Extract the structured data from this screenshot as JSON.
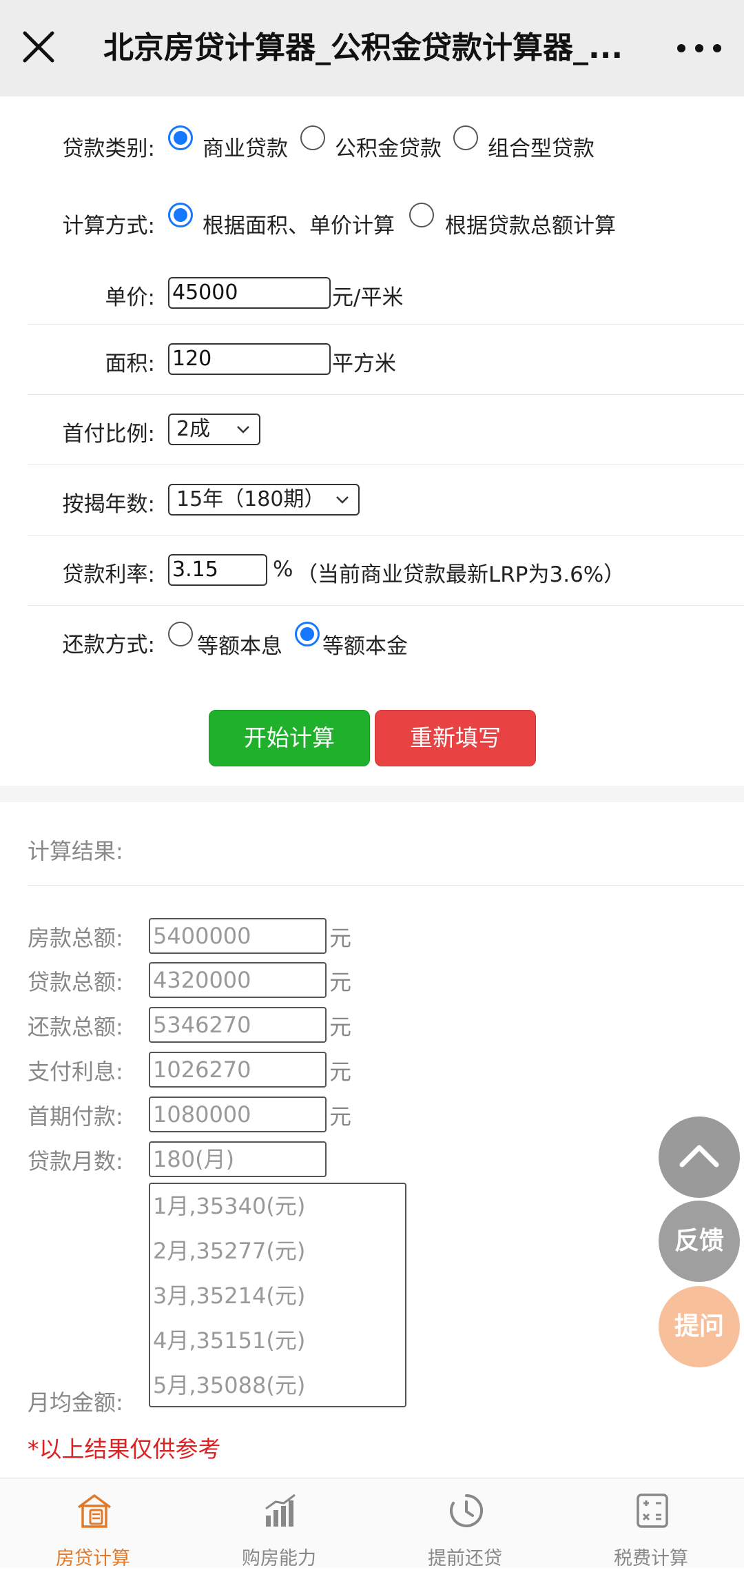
{
  "header": {
    "title": "北京房贷计算器_公积金贷款计算器_..."
  },
  "form": {
    "loan_type": {
      "label": "贷款类别:",
      "options": [
        "商业贷款",
        "公积金贷款",
        "组合型贷款"
      ],
      "selected": "商业贷款"
    },
    "calc_method": {
      "label": "计算方式:",
      "options": [
        "根据面积、单价计算",
        "根据贷款总额计算"
      ],
      "selected": "根据面积、单价计算"
    },
    "unit_price": {
      "label": "单价:",
      "value": "45000",
      "unit": "元/平米"
    },
    "area": {
      "label": "面积:",
      "value": "120",
      "unit": "平方米"
    },
    "down_payment": {
      "label": "首付比例:",
      "value": "2成"
    },
    "years": {
      "label": "按揭年数:",
      "value": "15年（180期）"
    },
    "rate": {
      "label": "贷款利率:",
      "value": "3.15",
      "unit": "%",
      "note": "（当前商业贷款最新LRP为3.6%）"
    },
    "repay_method": {
      "label": "还款方式:",
      "options": [
        "等额本息",
        "等额本金"
      ],
      "selected": "等额本金"
    },
    "buttons": {
      "calculate": "开始计算",
      "reset": "重新填写"
    }
  },
  "results": {
    "title": "计算结果:",
    "rows": [
      {
        "label": "房款总额:",
        "value": "5400000",
        "unit": "元"
      },
      {
        "label": "贷款总额:",
        "value": "4320000",
        "unit": "元"
      },
      {
        "label": "还款总额:",
        "value": "5346270",
        "unit": "元"
      },
      {
        "label": "支付利息:",
        "value": "1026270",
        "unit": "元"
      },
      {
        "label": "首期付款:",
        "value": "1080000",
        "unit": "元"
      },
      {
        "label": "贷款月数:",
        "value": "180(月)",
        "unit": ""
      }
    ],
    "monthly_label": "月均金额:",
    "monthly": [
      "1月,35340(元)",
      "2月,35277(元)",
      "3月,35214(元)",
      "4月,35151(元)",
      "5月,35088(元)"
    ],
    "note": "*以上结果仅供参考"
  },
  "floating": {
    "feedback": "反馈",
    "ask": "提问"
  },
  "tabbar": {
    "items": [
      {
        "label": "房贷计算",
        "icon": "house-calc-icon"
      },
      {
        "label": "购房能力",
        "icon": "bar-chart-icon"
      },
      {
        "label": "提前还贷",
        "icon": "clock-icon"
      },
      {
        "label": "税费计算",
        "icon": "calculator-icon"
      }
    ],
    "active": "房贷计算",
    "active_color": "#e07a2a"
  }
}
